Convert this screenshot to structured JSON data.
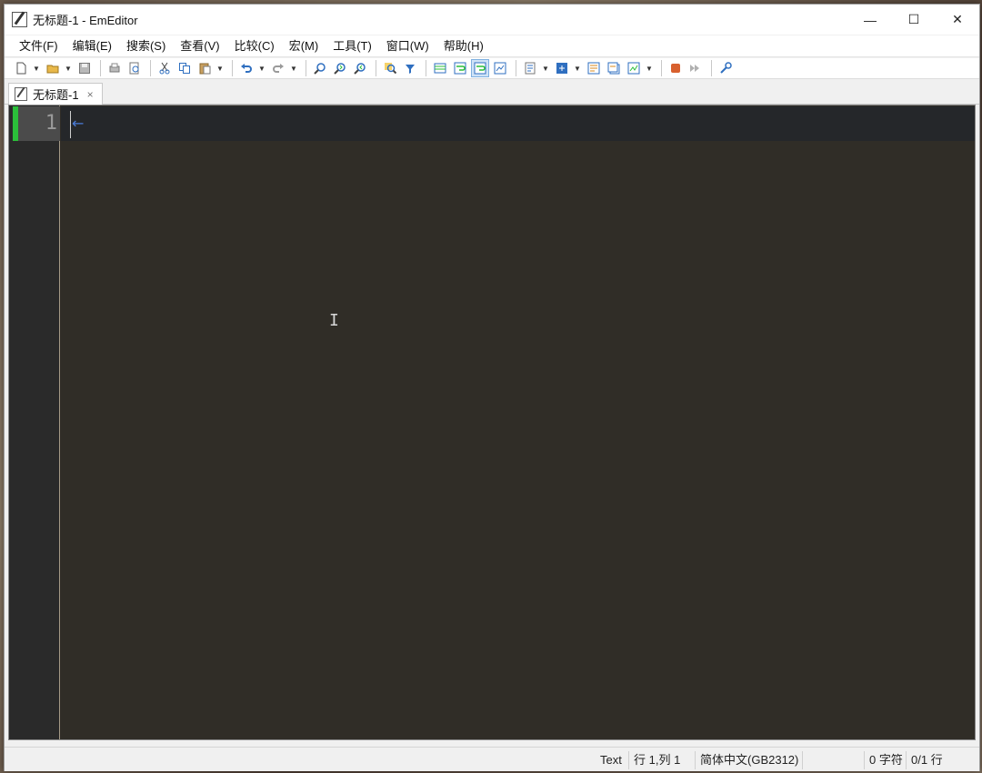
{
  "window": {
    "title": "无标题-1 - EmEditor",
    "controls": {
      "minimize": "—",
      "maximize": "☐",
      "close": "✕"
    }
  },
  "menu": [
    {
      "label": "文件(F)"
    },
    {
      "label": "编辑(E)"
    },
    {
      "label": "搜索(S)"
    },
    {
      "label": "查看(V)"
    },
    {
      "label": "比较(C)"
    },
    {
      "label": "宏(M)"
    },
    {
      "label": "工具(T)"
    },
    {
      "label": "窗口(W)"
    },
    {
      "label": "帮助(H)"
    }
  ],
  "toolbar": {
    "icons": [
      "new-file-icon",
      "open-file-icon",
      "save-icon",
      "print-icon",
      "print-preview-icon",
      "cut-icon",
      "copy-icon",
      "paste-icon",
      "undo-icon",
      "redo-icon",
      "find-icon",
      "find-next-icon",
      "find-previous-icon",
      "highlight-search-icon",
      "filter-icon",
      "csv-mode-icon",
      "word-wrap-icon",
      "window-wrap-icon",
      "page-wrap-icon",
      "properties-icon",
      "encoding-icon",
      "marks-icon",
      "markers-icon",
      "document-view-icon",
      "macro-record-icon",
      "macro-run-icon",
      "plugins-icon"
    ],
    "colors": {
      "accent_blue": "#2f6fc0",
      "accent_orange": "#d8891e",
      "active_bg": "#cfe3f7"
    }
  },
  "tab": {
    "label": "无标题-1",
    "close": "×"
  },
  "editor": {
    "line_number": "1",
    "eol_mark": "←",
    "colors": {
      "background": "#302d27",
      "gutter": "#2a2a2a",
      "current_line": "#25272a",
      "modified_marker": "#2bbf3a",
      "eol_mark": "#4a7bd8"
    }
  },
  "status": {
    "mode": "Text",
    "position": "行 1,列 1",
    "encoding": "简体中文(GB2312)",
    "char_count": "0 字符",
    "line_count": "0/1 行"
  }
}
